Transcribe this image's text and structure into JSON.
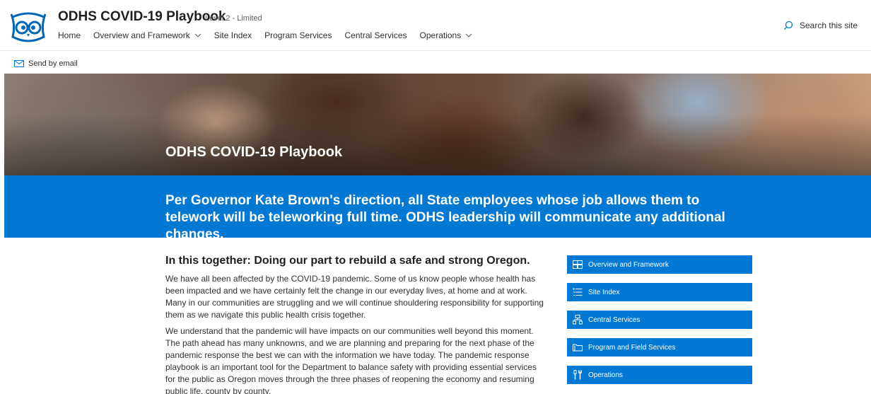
{
  "header": {
    "site_title": "ODHS COVID-19 Playbook",
    "classification": "Level 2 - Limited",
    "nav": [
      {
        "label": "Home",
        "has_dropdown": false
      },
      {
        "label": "Overview and Framework",
        "has_dropdown": true
      },
      {
        "label": "Site Index",
        "has_dropdown": false
      },
      {
        "label": "Program Services",
        "has_dropdown": false
      },
      {
        "label": "Central Services",
        "has_dropdown": false
      },
      {
        "label": "Operations",
        "has_dropdown": true
      }
    ],
    "search_placeholder": "Search this site"
  },
  "command_bar": {
    "send_email_label": "Send by email"
  },
  "hero": {
    "title": "ODHS COVID-19 Playbook"
  },
  "banner": {
    "text": "Per Governor Kate Brown's direction, all State employees whose job allows them to telework will be teleworking full time. ODHS leadership will communicate any additional changes."
  },
  "article": {
    "heading": "In this together: Doing our part to rebuild a safe and strong Oregon.",
    "paragraphs": [
      "We have all been affected by the COVID-19 pandemic. Some of us know people whose health has been impacted and we have certainly felt the change in our everyday lives, at home and at work. Many in our communities are struggling and we will continue shouldering responsibility for supporting them as we navigate this public health crisis together.",
      "We understand that the pandemic will have impacts on our communities well beyond this moment. The path ahead has many unknowns, and we are planning and preparing for the next phase of the pandemic response the best we can with the information we have today. The pandemic response playbook is an important tool for the Department to balance safety with providing essential services for the public as Oregon moves through the three phases of reopening the economy and resuming public life, county by county."
    ]
  },
  "quick_links": [
    {
      "label": "Overview and Framework",
      "icon": "layout-icon"
    },
    {
      "label": "Site Index",
      "icon": "list-icon"
    },
    {
      "label": "Central Services",
      "icon": "org-chart-icon"
    },
    {
      "label": "Program and Field Services",
      "icon": "folder-icon"
    },
    {
      "label": "Operations",
      "icon": "tools-icon"
    }
  ],
  "colors": {
    "accent": "#0078d4",
    "text": "#323130"
  }
}
